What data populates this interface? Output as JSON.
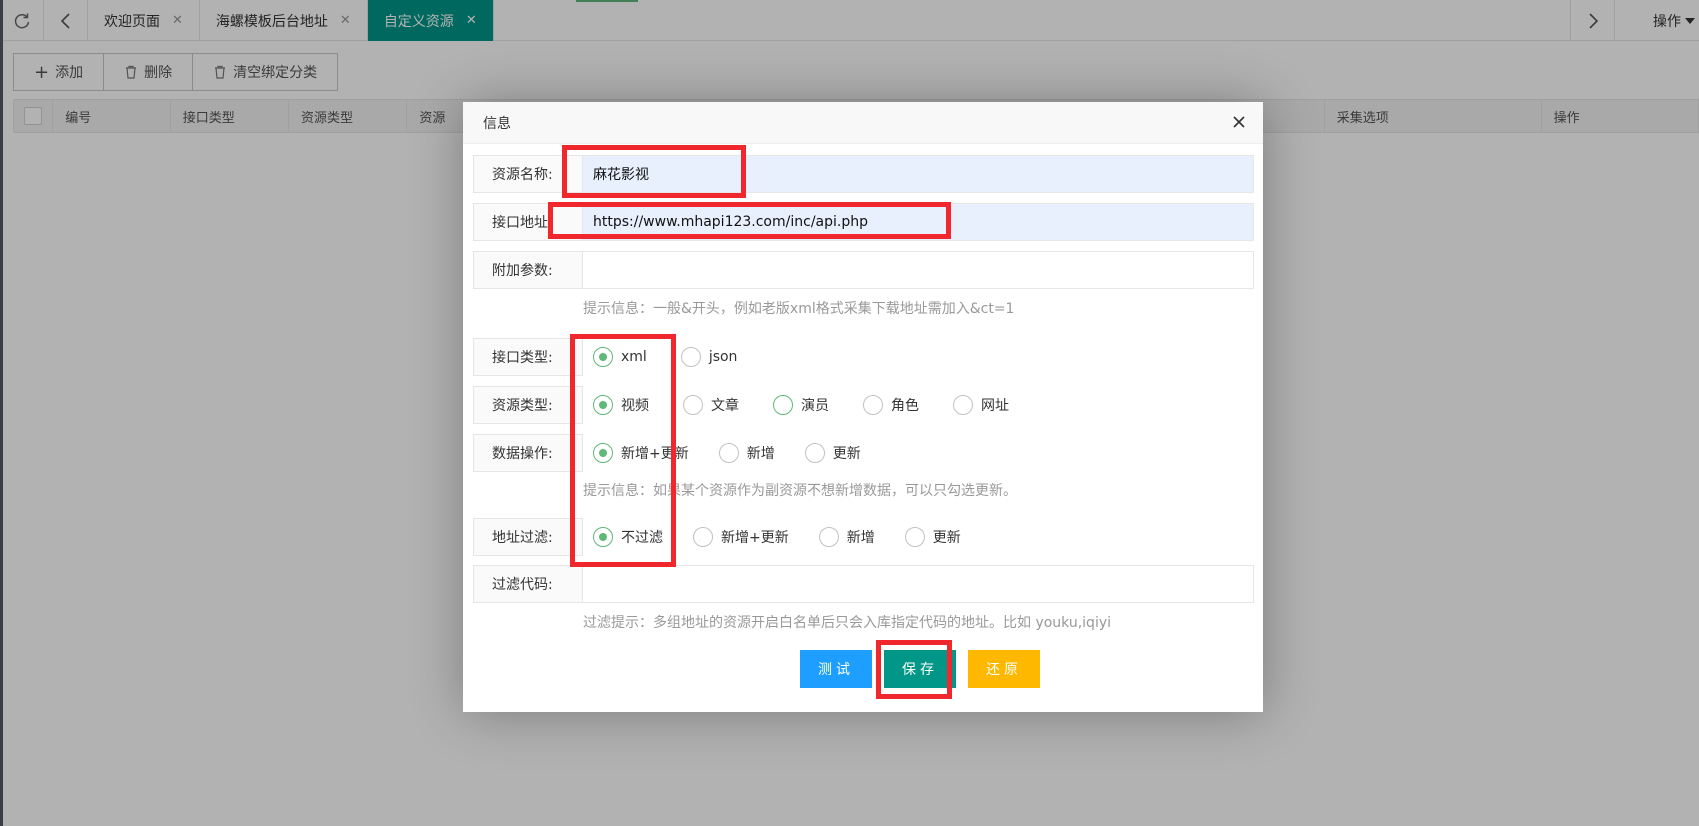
{
  "tabs": {
    "items": [
      {
        "label": "欢迎页面",
        "active": false
      },
      {
        "label": "海螺模板后台地址",
        "active": false
      },
      {
        "label": "自定义资源",
        "active": true
      }
    ],
    "operations_label": "操作"
  },
  "toolbar": {
    "add_label": "添加",
    "delete_label": "删除",
    "clear_label": "清空绑定分类"
  },
  "grid": {
    "columns": [
      "编号",
      "接口类型",
      "资源类型",
      "资源",
      "采集选项",
      "操作"
    ]
  },
  "modal": {
    "title": "信息",
    "fields": {
      "name": {
        "label": "资源名称:",
        "value": "麻花影视"
      },
      "api_url": {
        "label": "接口地址",
        "value": "https://www.mhapi123.com/inc/api.php"
      },
      "extra_params": {
        "label": "附加参数:",
        "value": ""
      },
      "extra_tip": "提示信息：一般&开头，例如老版xml格式采集下载地址需加入&ct=1",
      "api_type": {
        "label": "接口类型:",
        "options": [
          "xml",
          "json"
        ],
        "selected": "xml"
      },
      "resource_type": {
        "label": "资源类型:",
        "options": [
          "视频",
          "文章",
          "演员",
          "角色",
          "网址"
        ],
        "selected": "视频"
      },
      "data_op": {
        "label": "数据操作:",
        "options": [
          "新增+更新",
          "新增",
          "更新"
        ],
        "selected": "新增+更新"
      },
      "data_op_tip": "提示信息：如果某个资源作为副资源不想新增数据，可以只勾选更新。",
      "url_filter": {
        "label": "地址过滤:",
        "options": [
          "不过滤",
          "新增+更新",
          "新增",
          "更新"
        ],
        "selected": "不过滤"
      },
      "filter_code": {
        "label": "过滤代码:",
        "value": ""
      },
      "filter_tip": "过滤提示：多组地址的资源开启白名单后只会入库指定代码的地址。比如 youku,iqiyi"
    },
    "buttons": {
      "test": "测试",
      "save": "保存",
      "reset": "还原"
    }
  },
  "colors": {
    "active_tab": "#009688",
    "radio_checked": "#5fb878",
    "btn_test": "#1e9fff",
    "btn_save": "#009688",
    "btn_reset": "#ffb800",
    "annotation": "#f0282d"
  }
}
